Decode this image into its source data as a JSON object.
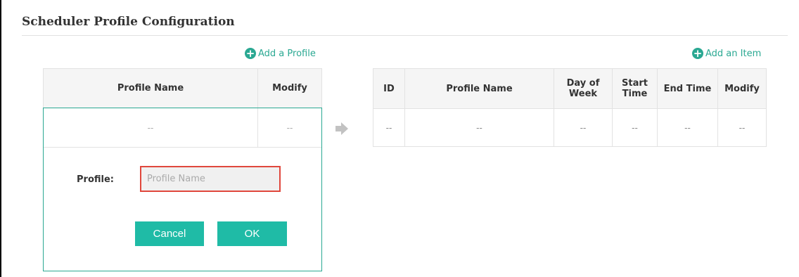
{
  "section": {
    "title": "Scheduler Profile Configuration"
  },
  "profile_table": {
    "add_label": "Add a Profile",
    "headers": [
      "Profile Name",
      "Modify"
    ],
    "row": [
      "--",
      "--"
    ],
    "form": {
      "profile_label": "Profile:",
      "input_placeholder": "Profile Name",
      "input_value": "",
      "cancel_label": "Cancel",
      "ok_label": "OK"
    }
  },
  "item_table": {
    "add_label": "Add an Item",
    "headers": [
      "ID",
      "Profile Name",
      "Day of Week",
      "Start Time",
      "End Time",
      "Modify"
    ],
    "row": [
      "--",
      "--",
      "--",
      "--",
      "--",
      "--"
    ]
  },
  "colors": {
    "accent": "#2aa892",
    "button": "#1fbba6",
    "error_border": "#e0473c"
  },
  "icons": {
    "add": "plus-circle-icon",
    "arrow": "arrow-right-icon"
  }
}
